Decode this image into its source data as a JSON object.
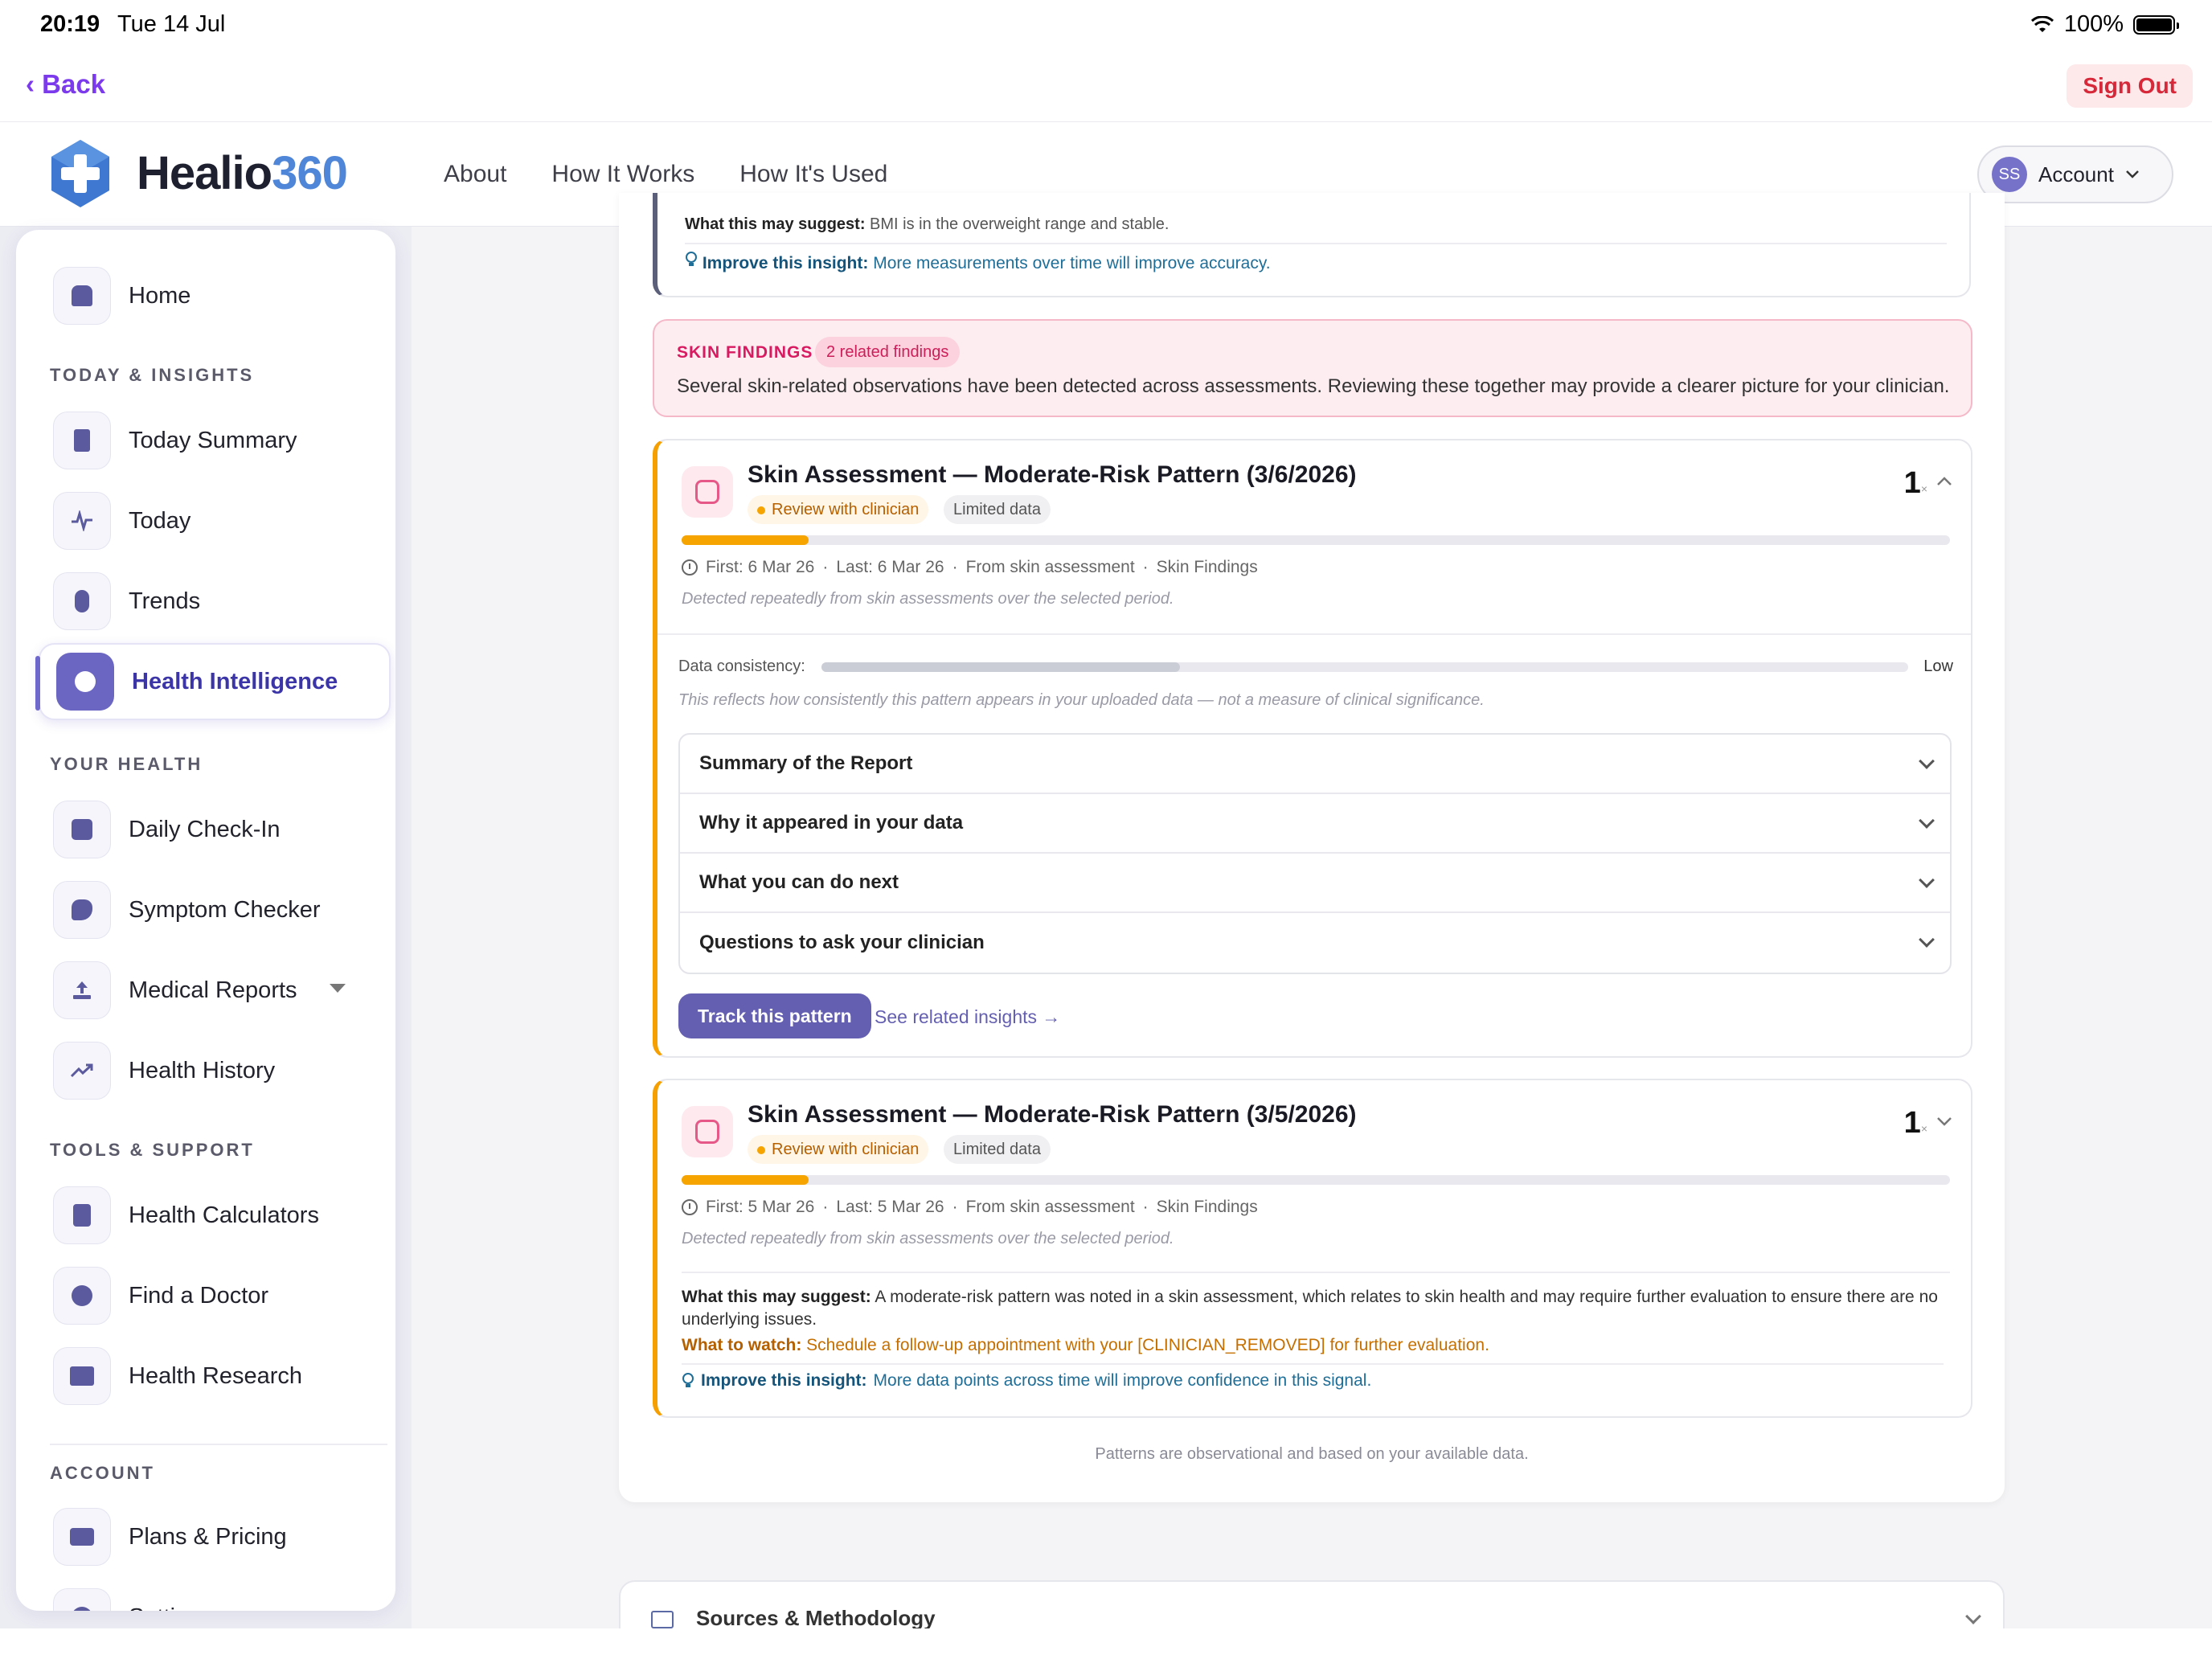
{
  "status_bar": {
    "time": "20:19",
    "date": "Tue 14 Jul",
    "battery": "100%"
  },
  "top_bar": {
    "back_label": "‹ Back",
    "sign_out_label": "Sign Out"
  },
  "brand": {
    "name_part1": "Healio",
    "name_part2": "360",
    "accent_color": "#4f86d8"
  },
  "nav": {
    "links": [
      "About",
      "How It Works",
      "How It's Used"
    ],
    "account_label": "Account",
    "avatar_initials": "SS"
  },
  "sidebar": {
    "home": "Home",
    "sections": {
      "today": "TODAY & INSIGHTS",
      "health": "YOUR HEALTH",
      "tools": "TOOLS & SUPPORT",
      "account": "ACCOUNT"
    },
    "items": {
      "today_summary": "Today Summary",
      "today": "Today",
      "trends": "Trends",
      "health_intelligence": "Health Intelligence",
      "daily_checkin": "Daily Check-In",
      "symptom_checker": "Symptom Checker",
      "medical_reports": "Medical Reports",
      "health_history": "Health History",
      "health_calculators": "Health Calculators",
      "find_doctor": "Find a Doctor",
      "health_research": "Health Research",
      "plans_pricing": "Plans & Pricing",
      "settings_partial": "Setti..."
    }
  },
  "top_card": {
    "suggest_label": "What this may suggest:",
    "suggest_text": "BMI is in the overweight range and stable.",
    "improve_label": "Improve this insight:",
    "improve_text": "More measurements over time will improve accuracy."
  },
  "skin_findings": {
    "title": "SKIN FINDINGS",
    "pill": "2 related findings",
    "text": "Several skin-related observations have been detected across assessments. Reviewing these together may provide a clearer picture for your clinician."
  },
  "pattern1": {
    "title": "Skin Assessment — Moderate-Risk Pattern (3/6/2026)",
    "badge_review": "Review with clinician",
    "badge_data": "Limited data",
    "count": "1",
    "count_suffix": "×",
    "progress_pct": 10,
    "first": "First: 6 Mar 26",
    "last": "Last: 6 Mar 26",
    "source": "From skin assessment",
    "category": "Skin Findings",
    "note": "Detected repeatedly from skin assessments over the selected period.",
    "consistency_label": "Data consistency:",
    "consistency_pct": 33,
    "consistency_level": "Low",
    "consistency_note": "This reflects how consistently this pattern appears in your uploaded data — not a measure of clinical significance.",
    "accordion": [
      "Summary of the Report",
      "Why it appeared in your data",
      "What you can do next",
      "Questions to ask your clinician"
    ],
    "track_label": "Track this pattern",
    "related_label": "See related insights →"
  },
  "pattern2": {
    "title": "Skin Assessment — Moderate-Risk Pattern (3/5/2026)",
    "badge_review": "Review with clinician",
    "badge_data": "Limited data",
    "count": "1",
    "count_suffix": "×",
    "progress_pct": 10,
    "first": "First: 5 Mar 26",
    "last": "Last: 5 Mar 26",
    "source": "From skin assessment",
    "category": "Skin Findings",
    "note": "Detected repeatedly from skin assessments over the selected period.",
    "suggest_label": "What this may suggest:",
    "suggest_text": "A moderate-risk pattern was noted in a skin assessment, which relates to skin health and may require further evaluation to ensure there are no underlying issues.",
    "watch_label": "What to watch:",
    "watch_text": "Schedule a follow-up appointment with your [CLINICIAN_REMOVED] for further evaluation.",
    "improve_label": "Improve this insight:",
    "improve_text": "More data points across time will improve confidence in this signal."
  },
  "footnote": "Patterns are observational and based on your available data.",
  "sources_label": "Sources & Methodology",
  "meta_separator": "·"
}
